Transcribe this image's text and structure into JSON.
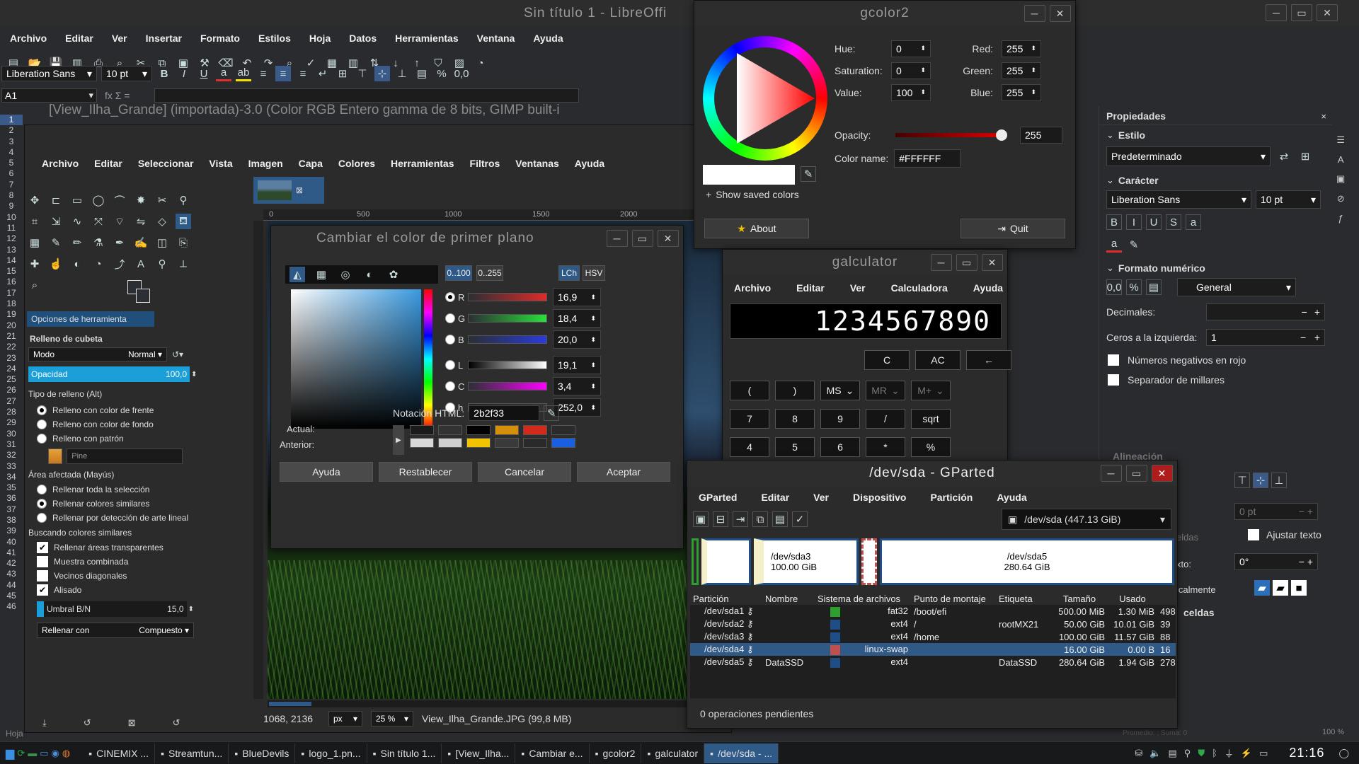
{
  "libreoffice": {
    "title": "Sin título 1 - LibreOffi",
    "menu": [
      "Archivo",
      "Editar",
      "Ver",
      "Insertar",
      "Formato",
      "Estilos",
      "Hoja",
      "Datos",
      "Herramientas",
      "Ventana",
      "Ayuda"
    ],
    "font_name": "Liberation Sans",
    "font_size": "10 pt",
    "cell_ref": "A1",
    "formula_icons": "fx Σ =",
    "row_numbers": [
      "1",
      "2",
      "3",
      "4",
      "5",
      "6",
      "7",
      "8",
      "9",
      "10",
      "11",
      "12",
      "13",
      "14",
      "15",
      "16",
      "17",
      "18",
      "19",
      "20",
      "21",
      "22",
      "23",
      "24",
      "25",
      "26",
      "27",
      "28",
      "29",
      "30",
      "31",
      "32",
      "33",
      "34",
      "35",
      "36",
      "37",
      "38",
      "39",
      "40",
      "41",
      "42",
      "43",
      "44",
      "45",
      "46"
    ],
    "sheet_tab": "Hoja",
    "status_center": "Promedio: ; Suma: 0",
    "zoom": "100 %",
    "sidebar": {
      "title": "Propiedades",
      "estilo": "Estilo",
      "estilo_value": "Predeterminado",
      "caracter": "Carácter",
      "font_name": "Liberation Sans",
      "font_size": "10 pt",
      "formato_numerico": "Formato numérico",
      "format_value": "General",
      "decimales": "Decimales:",
      "ceros": "Ceros a la izquierda:",
      "ceros_value": "1",
      "negativos": "Números negativos en rojo",
      "separador": "Separador de millares",
      "alineacion": "Alineación",
      "indent_value": "0 pt",
      "ajustar": "Ajustar texto",
      "angle_value": "0°",
      "celdas_partial": "eldas",
      "texto_partial": "xto:",
      "vert_partial": "icalmente",
      "bordes": "celdas"
    }
  },
  "gimp": {
    "title": "[View_Ilha_Grande] (importada)-3.0 (Color RGB Entero gamma de 8 bits, GIMP built-i",
    "menu": [
      "Archivo",
      "Editar",
      "Seleccionar",
      "Vista",
      "Imagen",
      "Capa",
      "Colores",
      "Herramientas",
      "Filtros",
      "Ventanas",
      "Ayuda"
    ],
    "tool_options_tab": "Opciones de herramienta",
    "tool_name": "Relleno de cubeta",
    "modo_label": "Modo",
    "modo_value": "Normal",
    "opacidad_label": "Opacidad",
    "opacidad_value": "100,0",
    "tipo_relleno": "Tipo de relleno  (Alt)",
    "fill_options": [
      "Relleno con color de frente",
      "Relleno con color de fondo",
      "Relleno con patrón"
    ],
    "pattern_name": "Pine",
    "area_afectada": "Área afectada  (Mayús)",
    "area_options": [
      "Rellenar toda la selección",
      "Rellenar colores similares",
      "Rellenar por detección de arte lineal"
    ],
    "buscando": "Buscando colores similares",
    "checks": [
      {
        "label": "Rellenar áreas transparentes",
        "checked": true
      },
      {
        "label": "Muestra combinada",
        "checked": false
      },
      {
        "label": "Vecinos diagonales",
        "checked": false
      },
      {
        "label": "Alisado",
        "checked": true
      }
    ],
    "umbral_label": "Umbral B/N",
    "umbral_value": "15,0",
    "rellenar_con": "Rellenar con",
    "rellenar_con_value": "Compuesto",
    "ruler_marks": [
      "0",
      "500",
      "1000",
      "1500",
      "2000"
    ],
    "coords": "1068, 2136",
    "unit": "px",
    "zoom": "25 %",
    "status_file": "View_Ilha_Grande.JPG (99,8 MB)"
  },
  "color_dialog": {
    "title": "Cambiar el color de primer plano",
    "range_a": "0..100",
    "range_b": "0..255",
    "mode_a": "LCh",
    "mode_b": "HSV",
    "channels": [
      {
        "label": "R",
        "value": "16,9"
      },
      {
        "label": "G",
        "value": "18,4"
      },
      {
        "label": "B",
        "value": "20,0"
      },
      {
        "label": "L",
        "value": "19,1"
      },
      {
        "label": "C",
        "value": "3,4"
      },
      {
        "label": "h",
        "value": "252,0"
      }
    ],
    "html_label": "Notación HTML:",
    "html_value": "2b2f33",
    "actual": "Actual:",
    "anterior": "Anterior:",
    "history_colors": [
      "#1a1a1a",
      "#333333",
      "#000000",
      "#d4900a",
      "#d42a1c",
      "#2a2a2a",
      "#d8d8d8",
      "#cfcfcf",
      "#f2c300",
      "#3a3a3a",
      "#2a2a2a",
      "#1a5fe0"
    ],
    "buttons": [
      "Ayuda",
      "Restablecer",
      "Cancelar",
      "Aceptar"
    ]
  },
  "gcolor2": {
    "title": "gcolor2",
    "hue_label": "Hue:",
    "hue": "0",
    "sat_label": "Saturation:",
    "sat": "0",
    "val_label": "Value:",
    "val": "100",
    "red_label": "Red:",
    "red": "255",
    "green_label": "Green:",
    "green": "255",
    "blue_label": "Blue:",
    "blue": "255",
    "opacity_label": "Opacity:",
    "opacity": "255",
    "colorname_label": "Color name:",
    "colorname": "#FFFFFF",
    "show_saved": "Show saved colors",
    "about": "About",
    "quit": "Quit"
  },
  "galculator": {
    "title": "galculator",
    "menu": [
      "Archivo",
      "Editar",
      "Ver",
      "Calculadora",
      "Ayuda"
    ],
    "display": "1234567890",
    "row1": [
      "C",
      "AC",
      "←"
    ],
    "row2": [
      "(",
      ")",
      "MS",
      "MR",
      "M+"
    ],
    "row3": [
      "7",
      "8",
      "9",
      "/",
      "sqrt"
    ],
    "row4": [
      "4",
      "5",
      "6",
      "*",
      "%"
    ]
  },
  "gparted": {
    "title": "/dev/sda - GParted",
    "menu": [
      "GParted",
      "Editar",
      "Ver",
      "Dispositivo",
      "Partición",
      "Ayuda"
    ],
    "device": "/dev/sda   (447.13 GiB)",
    "bar": [
      {
        "name": "/dev/sda3",
        "size": "100.00 GiB"
      },
      {
        "name": "/dev/sda5",
        "size": "280.64 GiB"
      }
    ],
    "headers": [
      "Partición",
      "Nombre",
      "Sistema de archivos",
      "Punto de montaje",
      "Etiqueta",
      "Tamaño",
      "Usado"
    ],
    "rows": [
      {
        "part": "/dev/sda1",
        "name": "",
        "color": "#2e9e2e",
        "fs": "fat32",
        "mount": "/boot/efi",
        "label": "",
        "size": "500.00 MiB",
        "used": "1.30 MiB",
        "extra": "498"
      },
      {
        "part": "/dev/sda2",
        "name": "",
        "color": "#1f4e86",
        "fs": "ext4",
        "mount": "/",
        "label": "rootMX21",
        "size": "50.00 GiB",
        "used": "10.01 GiB",
        "extra": "39"
      },
      {
        "part": "/dev/sda3",
        "name": "",
        "color": "#1f4e86",
        "fs": "ext4",
        "mount": "/home",
        "label": "",
        "size": "100.00 GiB",
        "used": "11.57 GiB",
        "extra": "88"
      },
      {
        "part": "/dev/sda4",
        "name": "",
        "color": "#c0504d",
        "fs": "linux-swap",
        "mount": "",
        "label": "",
        "size": "16.00 GiB",
        "used": "0.00 B",
        "extra": "16"
      },
      {
        "part": "/dev/sda5",
        "name": "DataSSD",
        "color": "#1f4e86",
        "fs": "ext4",
        "mount": "",
        "label": "DataSSD",
        "size": "280.64 GiB",
        "used": "1.94 GiB",
        "extra": "278"
      }
    ],
    "status": "0 operaciones pendientes"
  },
  "taskbar": {
    "items": [
      "CINEMIX ...",
      "Streamtun...",
      "BlueDevils",
      "logo_1.pn...",
      "Sin título 1...",
      "[View_Ilha...",
      "Cambiar e...",
      "gcolor2",
      "galculator",
      "/dev/sda - ..."
    ],
    "clock": "21:16"
  }
}
